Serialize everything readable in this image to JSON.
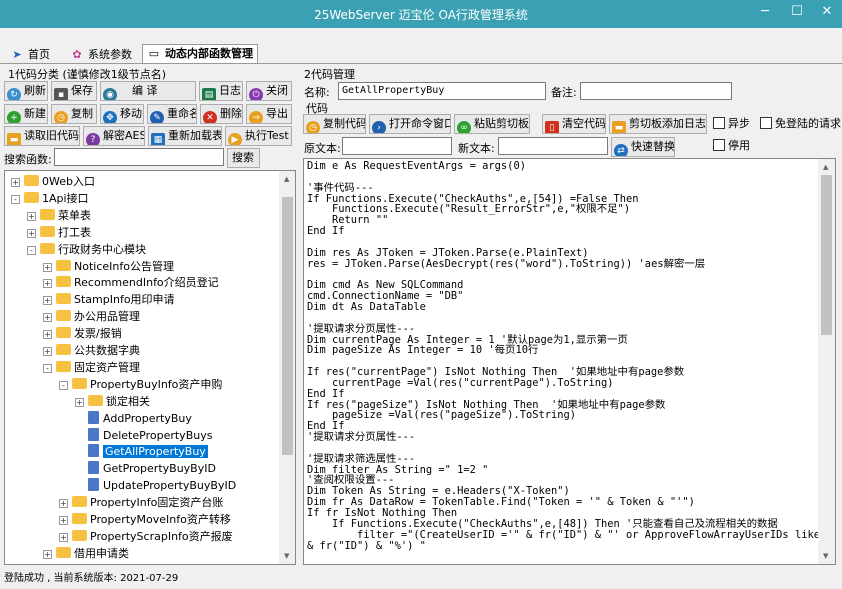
{
  "window": {
    "title": "25WebServer 迈宝伦 OA行政管理系统"
  },
  "tabs": [
    {
      "label": "首页"
    },
    {
      "label": "系统参数"
    },
    {
      "label": "动态内部函数管理"
    }
  ],
  "left": {
    "group_label": "1代码分类 (谨慎修改1级节点名)",
    "buttons": {
      "refresh": "刷新",
      "save": "保存",
      "edit": "编 译",
      "log": "日志",
      "close": "关闭",
      "new": "新建",
      "copy": "复制",
      "move": "移动",
      "rename": "重命名",
      "delete": "删除",
      "export": "导出",
      "read_old": "读取旧代码",
      "decrypt": "解密AES",
      "reload": "重新加载表",
      "exec": "执行Test"
    },
    "search_label": "搜索函数:",
    "search_value": "",
    "search_button": "搜索",
    "tree": [
      {
        "label": "0Web入口",
        "level": 0,
        "type": "folder",
        "exp": "+"
      },
      {
        "label": "1Api接口",
        "level": 0,
        "type": "folder",
        "exp": "-"
      },
      {
        "label": "菜单表",
        "level": 1,
        "type": "folder",
        "exp": "+"
      },
      {
        "label": "打工表",
        "level": 1,
        "type": "folder",
        "exp": "+"
      },
      {
        "label": "行政财务中心模块",
        "level": 1,
        "type": "folder",
        "exp": "-"
      },
      {
        "label": "NoticeInfo公告管理",
        "level": 2,
        "type": "folder",
        "exp": "+"
      },
      {
        "label": "RecommendInfo介绍员登记",
        "level": 2,
        "type": "folder",
        "exp": "+"
      },
      {
        "label": "StampInfo用印申请",
        "level": 2,
        "type": "folder",
        "exp": "+"
      },
      {
        "label": "办公用品管理",
        "level": 2,
        "type": "folder",
        "exp": "+"
      },
      {
        "label": "发票/报销",
        "level": 2,
        "type": "folder",
        "exp": "+"
      },
      {
        "label": "公共数据字典",
        "level": 2,
        "type": "folder",
        "exp": "+"
      },
      {
        "label": "固定资产管理",
        "level": 2,
        "type": "folder",
        "exp": "-"
      },
      {
        "label": "PropertyBuyInfo资产申购",
        "level": 3,
        "type": "folder",
        "exp": "-"
      },
      {
        "label": "锁定相关",
        "level": 4,
        "type": "folder",
        "exp": "+"
      },
      {
        "label": "AddPropertyBuy",
        "level": 4,
        "type": "doc",
        "exp": ""
      },
      {
        "label": "DeletePropertyBuys",
        "level": 4,
        "type": "doc",
        "exp": ""
      },
      {
        "label": "GetAllPropertyBuy",
        "level": 4,
        "type": "doc",
        "exp": "",
        "selected": true
      },
      {
        "label": "GetPropertyBuyByID",
        "level": 4,
        "type": "doc",
        "exp": ""
      },
      {
        "label": "UpdatePropertyBuyByID",
        "level": 4,
        "type": "doc",
        "exp": ""
      },
      {
        "label": "PropertyInfo固定资产台账",
        "level": 3,
        "type": "folder",
        "exp": "+"
      },
      {
        "label": "PropertyMoveInfo资产转移",
        "level": 3,
        "type": "folder",
        "exp": "+"
      },
      {
        "label": "PropertyScrapInfo资产报废",
        "level": 3,
        "type": "folder",
        "exp": "+"
      },
      {
        "label": "借用申请类",
        "level": 2,
        "type": "folder",
        "exp": "+"
      }
    ]
  },
  "right": {
    "group_label": "2代码管理",
    "name_label": "名称:",
    "name_value": "GetAllPropertyBuy",
    "remark_label": "备注:",
    "remark_value": "",
    "code_label": "代码",
    "buttons": {
      "copy_code": "复制代码",
      "open_cmd": "打开命令窗口",
      "paste": "粘贴剪切板",
      "clear": "清空代码",
      "clip_log": "剪切板添加日志",
      "replace": "快速替换"
    },
    "checks": {
      "async": "异步",
      "no_login": "免登陆的请求",
      "disable": "停用"
    },
    "orig_label": "原文本:",
    "orig_value": "",
    "new_label": "新文本:",
    "new_value": "",
    "code": "Dim e As RequestEventArgs = args(0)\n\n'事件代码---\nIf Functions.Execute(\"CheckAuths\",e,[54]) =False Then\n    Functions.Execute(\"Result_ErrorStr\",e,\"权限不足\")\n    Return \"\"\nEnd If\n\nDim res As JToken = JToken.Parse(e.PlainText)\nres = JToken.Parse(AesDecrypt(res(\"word\").ToString)) 'aes解密一层\n\nDim cmd As New SQLCommand\ncmd.ConnectionName = \"DB\"\nDim dt As DataTable\n\n'提取请求分页属性---\nDim currentPage As Integer = 1 '默认page为1,显示第一页\nDim pageSize As Integer = 10 '每页10行\n\nIf res(\"currentPage\") IsNot Nothing Then  '如果地址中有page参数\n    currentPage =Val(res(\"currentPage\").ToString)\nEnd If\nIf res(\"pageSize\") IsNot Nothing Then  '如果地址中有page参数\n    pageSize =Val(res(\"pageSize\").ToString)\nEnd If\n'提取请求分页属性---\n\n'提取请求筛选属性---\nDim filter As String =\" 1=2 \"\n'查阅权限设置---\nDim Token As String = e.Headers(\"X-Token\")\nDim fr As DataRow = TokenTable.Find(\"Token = '\" & Token & \"'\")\nIf fr IsNot Nothing Then\n    If Functions.Execute(\"CheckAuths\",e,[48]) Then '只能查看自己及流程相关的数据\n        filter =\"(CreateUserID ='\" & fr(\"ID\") & \"' or ApproveFlowArrayUserIDs like '%\"\n& fr(\"ID\") & \"%') \""
  },
  "status": "登陆成功 , 当前系统版本: 2021-07-29"
}
